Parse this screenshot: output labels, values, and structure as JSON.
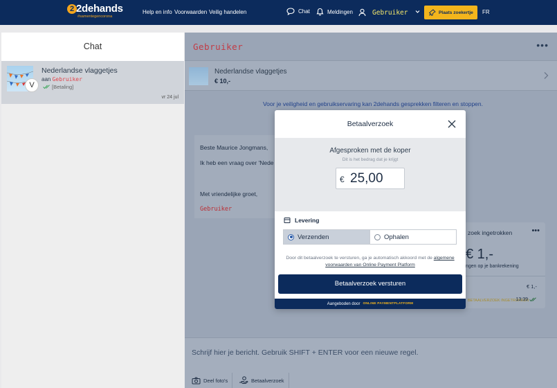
{
  "topbar": {
    "logo_main": "2dehands",
    "logo_sub": "#samentegencorona",
    "nav_help": "Help en info",
    "nav_terms": "Voorwaarden",
    "nav_safe": "Veilig handelen",
    "nav_chat": "Chat",
    "nav_notifications": "Meldingen",
    "username": "Gebruiker",
    "place_ad": "Plaats zoekertje",
    "language": "FR"
  },
  "left": {
    "header": "Chat",
    "conversation": {
      "title": "Nederlandse vlaggetjes",
      "to_prefix": "aan",
      "to_user": "Gebruiker",
      "status": "[Betaling]",
      "date": "vr 24 jul",
      "avatar_letter": "V"
    }
  },
  "right": {
    "username": "Gebruiker",
    "more": "•••",
    "listing": {
      "title": "Nederlandse vlaggetjes",
      "price": "€ 10,-"
    },
    "safety_text": "Voor je veiligheid en gebruikservaring kan 2dehands gesprekken filteren en stoppen.",
    "message": {
      "greeting": "Beste Maurice Jongmans,",
      "body": "Ik heb een vraag over 'Nede",
      "closing": "Met vriendelijke groet,",
      "signature": "Gebruiker"
    },
    "payment_card": {
      "title": "zoek ingetrokken",
      "dots": "•••",
      "amount": "€ 1,-",
      "sub": "ngen op je bankrekening",
      "small_amount": "€ 1,-",
      "status": "BETAALVERZOEK INGETROKKEN",
      "time": "13:39"
    },
    "input_placeholder": "Schrijf hier je bericht. Gebruik SHIFT + ENTER voor een nieuwe regel.",
    "btn_photos": "Deel foto's",
    "btn_payment": "Betaalverzoek"
  },
  "modal": {
    "title": "Betaalverzoek",
    "agreed_title": "Afgesproken met de koper",
    "agreed_sub": "Dit is het bedrag dat je krijgt",
    "currency": "€",
    "amount": "25,00",
    "delivery_label": "Levering",
    "option_send": "Verzenden",
    "option_pickup": "Ophalen",
    "selected_option": "Verzenden",
    "terms_text": "Door dit betaalverzoek te versturen, ga je automatisch akkoord met de",
    "terms_link": "algemene voorwaarden van Online Payment Platform",
    "send_button": "Betaalverzoek versturen",
    "powered_by": "Aangeboden door",
    "powered_brand": "ONLINE PAYMENTPLATFORM"
  },
  "colors": {
    "navy": "#0c2b5c",
    "accent_yellow": "#f3b51c",
    "username_red": "#e0454d",
    "link_blue": "#2a5ba8"
  }
}
